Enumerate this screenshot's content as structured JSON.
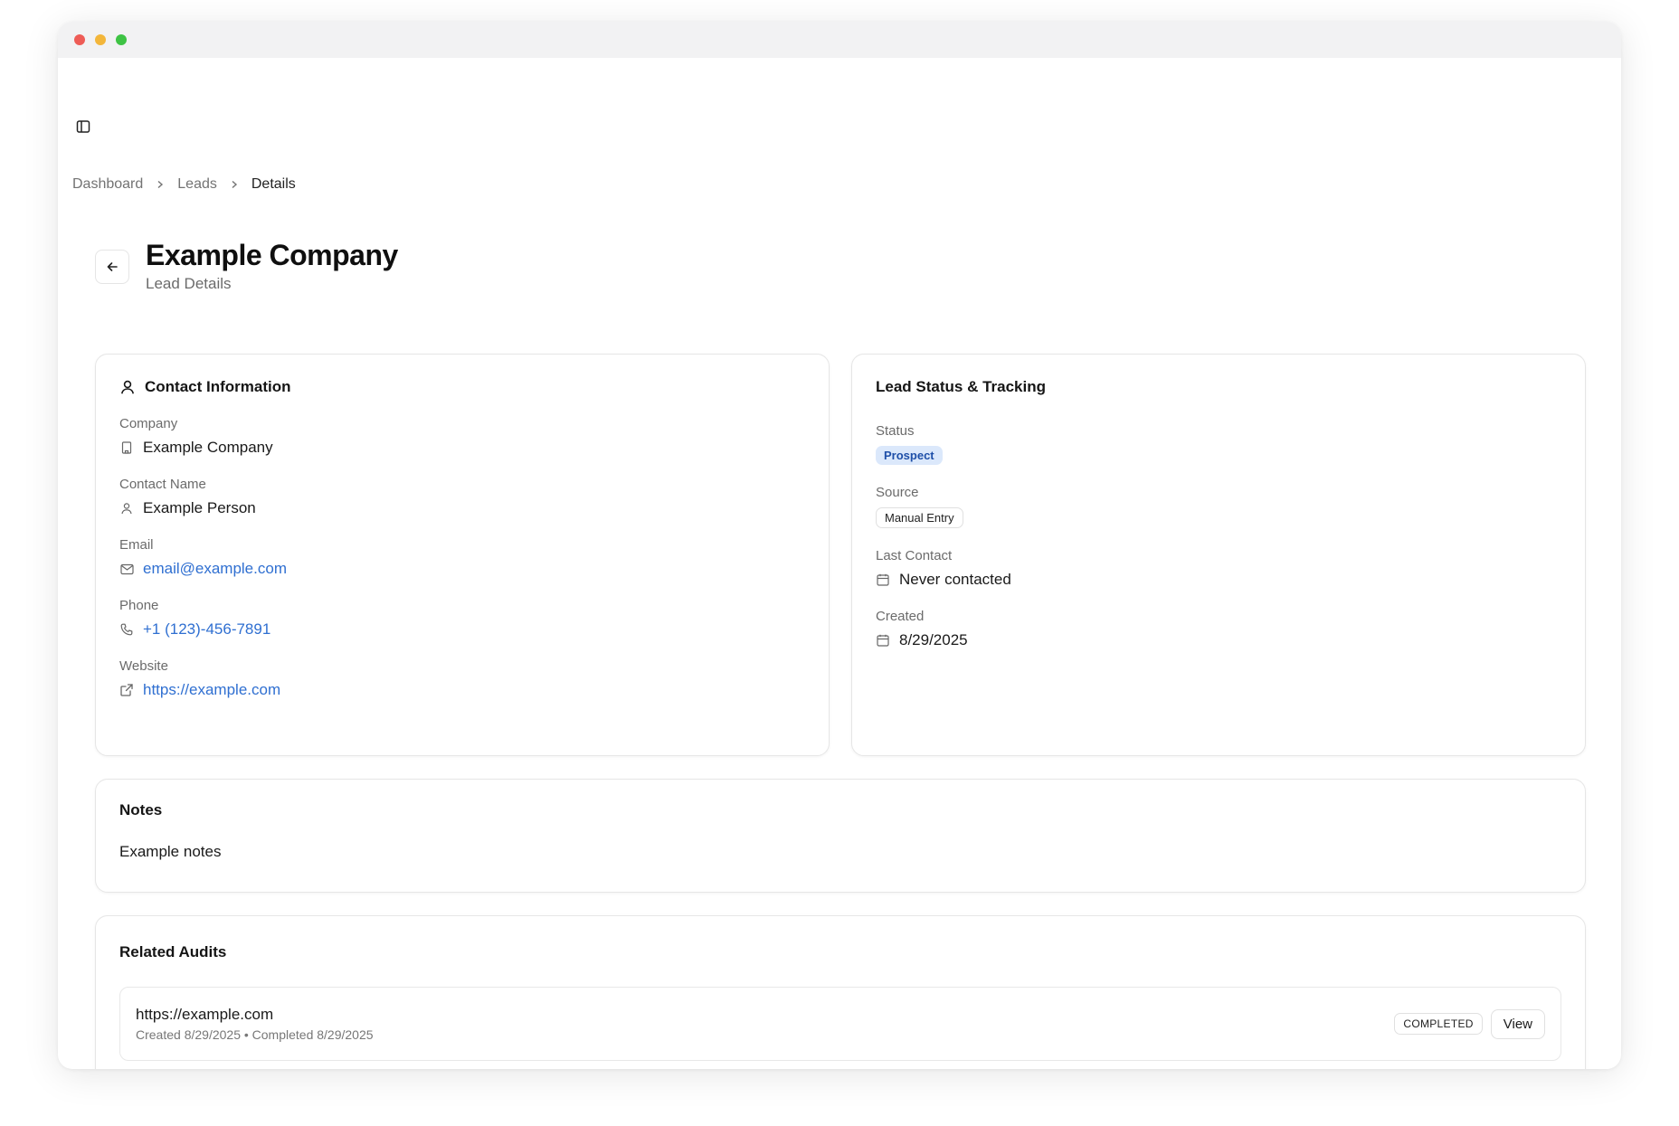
{
  "colors": {
    "traffic_red": "#ee5c56",
    "traffic_yellow": "#f3b63a",
    "traffic_green": "#3ec344",
    "link": "#2f6fd1",
    "prospect_badge_bg": "#dbe8fb",
    "prospect_badge_text": "#1e4fa8"
  },
  "icons": {
    "sidebar_toggle": "sidebar-panel-icon",
    "breadcrumb_separator": "chevron-right-icon",
    "back": "arrow-left-icon",
    "contact": "user-icon",
    "company": "building-icon",
    "contact_name": "user-icon",
    "email": "mail-icon",
    "phone": "phone-icon",
    "website": "external-link-icon",
    "calendar": "calendar-icon"
  },
  "breadcrumb": {
    "items": [
      "Dashboard",
      "Leads"
    ],
    "current": "Details"
  },
  "header": {
    "title": "Example Company",
    "subtitle": "Lead Details"
  },
  "contact": {
    "title": "Contact Information",
    "company_label": "Company",
    "company_value": "Example Company",
    "name_label": "Contact Name",
    "name_value": "Example Person",
    "email_label": "Email",
    "email_value": "email@example.com",
    "phone_label": "Phone",
    "phone_value": "+1 (123)-456-7891",
    "website_label": "Website",
    "website_value": "https://example.com"
  },
  "status": {
    "title": "Lead Status & Tracking",
    "status_label": "Status",
    "status_value": "Prospect",
    "source_label": "Source",
    "source_value": "Manual Entry",
    "last_contact_label": "Last Contact",
    "last_contact_value": "Never contacted",
    "created_label": "Created",
    "created_value": "8/29/2025"
  },
  "notes": {
    "title": "Notes",
    "text": "Example notes"
  },
  "audits": {
    "title": "Related Audits",
    "items": [
      {
        "url": "https://example.com",
        "meta": "Created 8/29/2025 • Completed 8/29/2025",
        "status": "COMPLETED",
        "action": "View"
      }
    ]
  }
}
